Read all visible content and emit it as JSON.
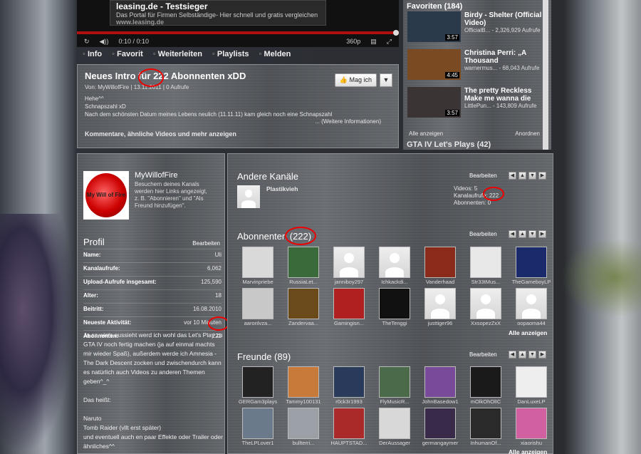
{
  "ad": {
    "title": "leasing.de - Testsieger",
    "desc": "Das Portal für Firmen Selbständige- Hier schnell und gratis vergleichen",
    "url": "www.leasing.de"
  },
  "player": {
    "time": "0:10 / 0:10",
    "quality": "360p",
    "replay": "Replay",
    "volume": "Volume",
    "quality_icon": "▤",
    "fullscreen_icon": "⤢"
  },
  "tabs": [
    "Info",
    "Favorit",
    "Weiterleiten",
    "Playlists",
    "Melden"
  ],
  "video": {
    "title": "Neues Intro für 222 Abonnenten xDD",
    "meta": "Von: MyWillofFire  | 13.11.2011  | 0 Aufrufe",
    "desc1": "Hehe^^",
    "desc2": "Schnapszahl xD",
    "desc3": "Nach dem schönsten Datum meines Lebens neulich (11.11.11) kam gleich noch eine Schnapszahl",
    "more": "... (Weitere Informationen)",
    "comments": "Kommentare, ähnliche Videos und mehr anzeigen",
    "like": "Mag ich",
    "dislike_icon": "thumb-down"
  },
  "favorites": {
    "header": "Favoriten (184)",
    "items": [
      {
        "title": "Birdy - Shelter (Official Video)",
        "sub": "OfficialB... - 2,326,929 Aufrufe",
        "dur": "3:57",
        "color": "#2b3a4a"
      },
      {
        "title": "Christina Perri: „A Thousand",
        "sub": "warnermus... - 68,043 Aufrufe",
        "dur": "4:45",
        "color": "#7a4a22"
      },
      {
        "title": "The pretty Reckless Make me wanna die",
        "sub": "LittlePun... - 143,809 Aufrufe",
        "dur": "3:57",
        "color": "#3a3434"
      }
    ],
    "show_all": "Alle anzeigen",
    "arrange": "Anordnen",
    "next": "GTA IV Let's Plays (42)"
  },
  "channel": {
    "name": "MyWillofFire",
    "info": "Besuchern deines Kanals werden hier Links angezeigt, z. B. \"Abonnieren\" und \"Als Freund hinzufügen\".",
    "logo_text": "My Will of Fire"
  },
  "profile": {
    "title": "Profil",
    "edit": "Bearbeiten",
    "rows": [
      {
        "k": "Name:",
        "v": "Uli"
      },
      {
        "k": "Kanalaufrufe:",
        "v": "6,062"
      },
      {
        "k": "Upload-Aufrufe insgesamt:",
        "v": "125,590"
      },
      {
        "k": "Alter:",
        "v": "18"
      },
      {
        "k": "Beitritt:",
        "v": "16.08.2010"
      },
      {
        "k": "Neueste Aktivität:",
        "v": "vor 10 Minuten"
      },
      {
        "k": "Abonnenten:",
        "v": "222"
      }
    ],
    "about": [
      "Ja so wie's aussieht werd ich wohl das Let's Play zu GTA IV noch fertig machen (ja auf einmal machts mir wieder Spaß), außerdem werde ich Amnesia - The Dark Descent zocken und zwischendurch kann es natürlich auch Videos zu anderen Themen geben^_^",
      "Das heißt:",
      "Naruto\nTomb Raider (vllt erst später)\nund eventuell auch en paar Effekte oder Trailer oder ähnliches^^"
    ]
  },
  "other_channels": {
    "title": "Andere Kanäle",
    "edit": "Bearbeiten",
    "name": "Plastikvieh",
    "videos": "Videos: 5",
    "views": "Kanalaufrufe: 222",
    "subs": "Abonnenten: 0"
  },
  "subscribers": {
    "title": "Abonnenten (222)",
    "edit": "Bearbeiten",
    "show_all": "Alle anzeigen",
    "items": [
      {
        "n": "Marvinpriebe",
        "c": "#d9d9d9"
      },
      {
        "n": "RussiaLet...",
        "c": "#3a6a3a"
      },
      {
        "n": "janniboy297",
        "c": ""
      },
      {
        "n": "Ichkackdi...",
        "c": ""
      },
      {
        "n": "Vanderhaad",
        "c": "#8a2a1a"
      },
      {
        "n": "Str33tMus...",
        "c": "#e8e8e8"
      },
      {
        "n": "TheGameboyLP",
        "c": "#1a2a6a"
      },
      {
        "n": "aaronlvza...",
        "c": "#c8c8c8"
      },
      {
        "n": "Zandervaa...",
        "c": "#6a4a1a"
      },
      {
        "n": "Gamingisn...",
        "c": "#b02020"
      },
      {
        "n": "TheTenggi",
        "c": "#111111"
      },
      {
        "n": "justtiger96",
        "c": ""
      },
      {
        "n": "XxsopezZxX",
        "c": ""
      },
      {
        "n": "oopaoma44",
        "c": ""
      }
    ]
  },
  "friends": {
    "title": "Freunde (89)",
    "edit": "Bearbeiten",
    "show_all": "Alle anzeigen",
    "items": [
      {
        "n": "GERGam3plays",
        "c": "#222222"
      },
      {
        "n": "Tammy100131",
        "c": "#c87a3a"
      },
      {
        "n": "r0ck3r1993",
        "c": "#2a3a5a"
      },
      {
        "n": "FlyMusicR...",
        "c": "#4a6a4a"
      },
      {
        "n": "JohnBasedow1",
        "c": "#7a4a9a"
      },
      {
        "n": "mOlkOhOlIC",
        "c": "#1a1a1a"
      },
      {
        "n": "DanLuxeLP",
        "c": "#eeeeee"
      },
      {
        "n": "TheLPLover1",
        "c": "#6a7a8a"
      },
      {
        "n": "bullterri...",
        "c": "#9aa0a6"
      },
      {
        "n": "HAUPTSTAD...",
        "c": "#aa2a2a"
      },
      {
        "n": "DerAussager",
        "c": "#d8d8d8"
      },
      {
        "n": "germangaymer",
        "c": "#3a2a4a"
      },
      {
        "n": "InhumanOf...",
        "c": "#2a2a2a"
      },
      {
        "n": "xiaorishu",
        "c": "#d060a0"
      }
    ]
  },
  "pager_icons": [
    "◀",
    "▲",
    "▼",
    "▶"
  ],
  "accent": "#e00000"
}
